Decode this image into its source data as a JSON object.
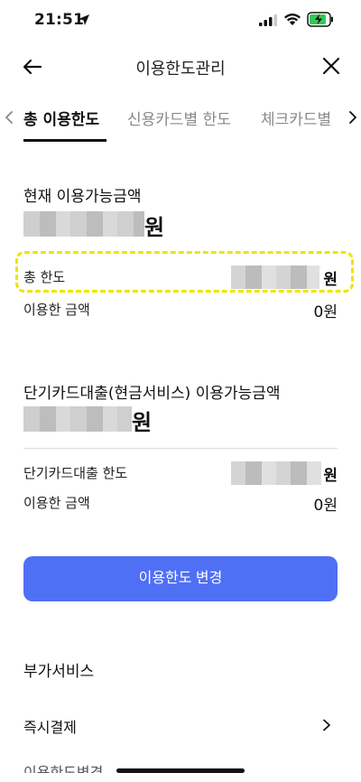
{
  "status_bar": {
    "time": "21:51"
  },
  "header": {
    "title": "이용한도관리"
  },
  "tabs": [
    {
      "label": "총 이용한도",
      "active": true
    },
    {
      "label": "신용카드별 한도",
      "active": false
    },
    {
      "label": "체크카드별",
      "active": false
    }
  ],
  "section_total": {
    "title": "현재 이용가능금액",
    "currency": "원",
    "limit_label": "총 한도",
    "limit_currency": "원",
    "used_label": "이용한 금액",
    "used_value": "0원"
  },
  "section_short_loan": {
    "title": "단기카드대출(현금서비스) 이용가능금액",
    "currency": "원",
    "limit_label": "단기카드대출 한도",
    "limit_currency": "원",
    "used_label": "이용한 금액",
    "used_value": "0원"
  },
  "change_button_label": "이용한도 변경",
  "extra_services": {
    "title": "부가서비스",
    "items": [
      {
        "label": "즉시결제"
      }
    ],
    "partial_item": "이용한도변경"
  },
  "colors": {
    "accent": "#4f6ff5",
    "highlight": "#f0e400"
  }
}
